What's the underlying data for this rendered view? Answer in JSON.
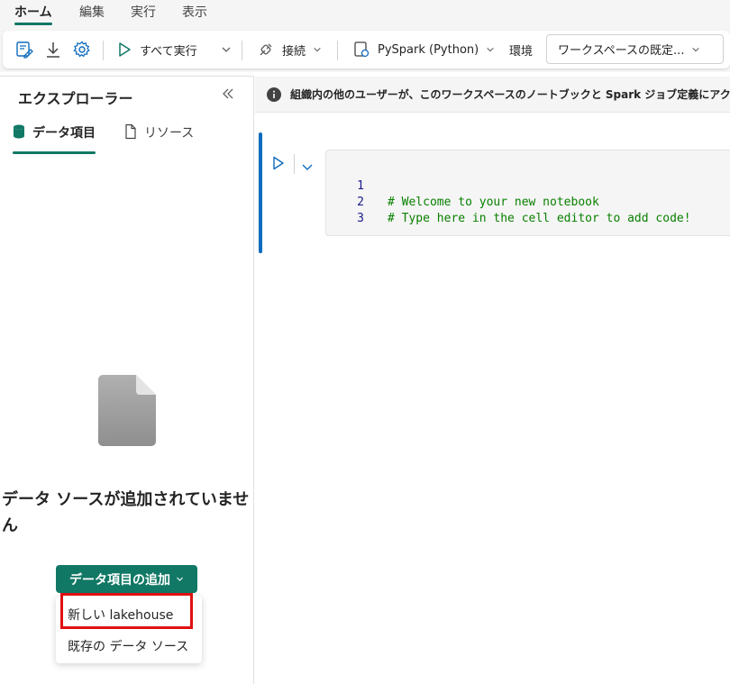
{
  "menu": {
    "tabs": [
      {
        "label": "ホーム",
        "active": true
      },
      {
        "label": "編集",
        "active": false
      },
      {
        "label": "実行",
        "active": false
      },
      {
        "label": "表示",
        "active": false
      }
    ]
  },
  "toolbar": {
    "run_all_label": "すべて実行",
    "connect_label": "接続",
    "language_label": "PySpark (Python)",
    "environment_label": "環境",
    "environment_value": "ワークスペースの既定..."
  },
  "explorer": {
    "title": "エクスプローラー",
    "tabs": [
      {
        "label": "データ項目",
        "active": true
      },
      {
        "label": "リソース",
        "active": false
      }
    ],
    "empty_title": "データ ソースが追加されていません",
    "add_button_label": "データ項目の追加",
    "dropdown_items": [
      "新しい lakehouse",
      "既存の データ ソース"
    ]
  },
  "infobar": {
    "text": "組織内の他のユーザーが、このワークスペースのノートブックと Spark ジョブ定義にアク"
  },
  "cell": {
    "lines": [
      {
        "number": "1",
        "code": "# Welcome to your new notebook"
      },
      {
        "number": "2",
        "code": "# Type here in the cell editor to add code!"
      },
      {
        "number": "3",
        "code": ""
      }
    ]
  },
  "colors": {
    "accent": "#117865",
    "cell_active_bar": "#0f6cbd",
    "comment": "#098000",
    "highlight": "#e01010"
  }
}
